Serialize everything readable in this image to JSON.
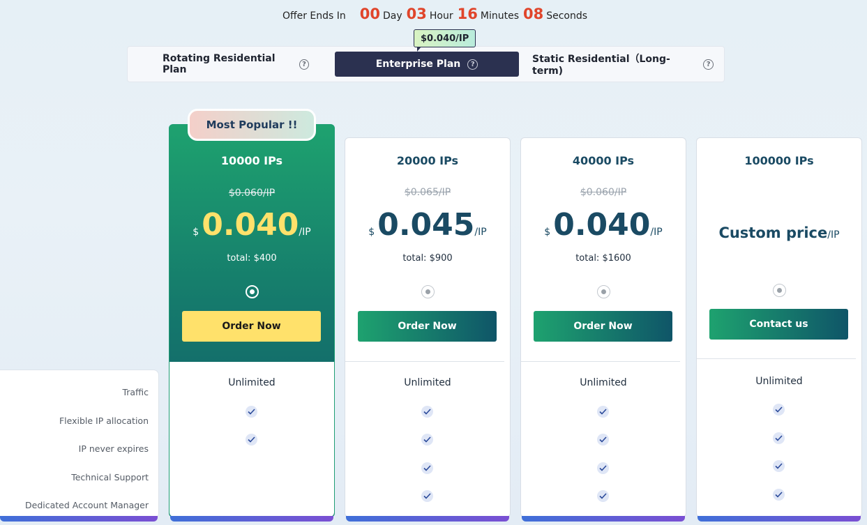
{
  "countdown": {
    "label": "Offer Ends In",
    "days": "00",
    "days_unit": "Day",
    "hours": "03",
    "hours_unit": "Hour",
    "minutes": "16",
    "minutes_unit": "Minutes",
    "seconds": "08",
    "seconds_unit": "Seconds"
  },
  "price_tag": "$0.040/IP",
  "tabs": [
    {
      "label": "Rotating Residential Plan",
      "active": false
    },
    {
      "label": "Enterprise Plan",
      "active": true
    },
    {
      "label": "Static Residential（Long-term)",
      "active": false
    }
  ],
  "features": [
    "Traffic",
    "Flexible IP allocation",
    "IP never expires",
    "Technical Support",
    "Dedicated Account Manager"
  ],
  "plans": [
    {
      "badge": "Most Popular !!",
      "ips": "10000 IPs",
      "old_price": "$0.060/IP",
      "currency": "$",
      "price": "0.040",
      "per": "/IP",
      "total": "total:  $400",
      "button": "Order Now",
      "traffic": "Unlimited",
      "selected": true
    },
    {
      "ips": "20000 IPs",
      "old_price": "$0.065/IP",
      "currency": "$",
      "price": "0.045",
      "per": "/IP",
      "total": "total:  $900",
      "button": "Order Now",
      "traffic": "Unlimited",
      "selected": false
    },
    {
      "ips": "40000 IPs",
      "old_price": "$0.060/IP",
      "currency": "$",
      "price": "0.040",
      "per": "/IP",
      "total": "total:  $1600",
      "button": "Order Now",
      "traffic": "Unlimited",
      "selected": false
    },
    {
      "ips": "100000 IPs",
      "custom_price": "Custom price",
      "per": "/IP",
      "button": "Contact us",
      "traffic": "Unlimited",
      "selected": false
    }
  ],
  "colors": {
    "accent_red": "#e0452b",
    "dark_navy": "#2b3150",
    "green_start": "#1ea26f",
    "teal_end": "#0f5568",
    "yellow_button": "#ffe16b",
    "highlight_price": "#ffe16b"
  },
  "icons": [
    "help-circle-icon",
    "check-icon",
    "radio-icon"
  ]
}
